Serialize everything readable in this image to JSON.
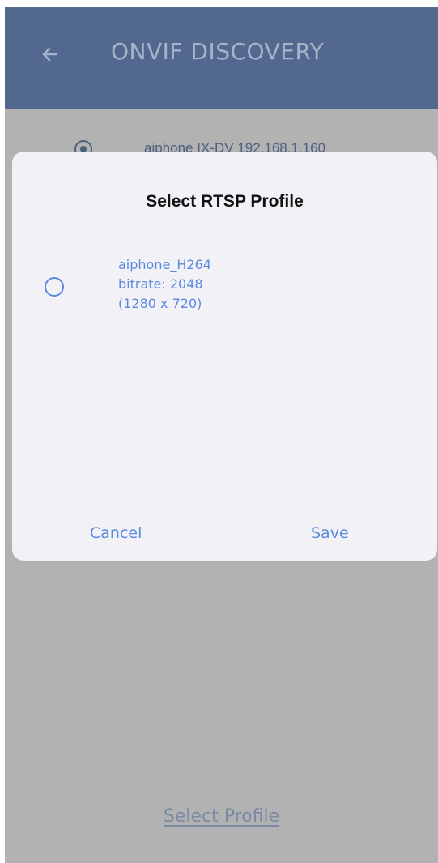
{
  "header": {
    "title": "ONVIF DISCOVERY",
    "back_icon": "arrow-left-icon"
  },
  "device_list": {
    "items": [
      {
        "label": "aiphone IX-DV 192.168.1.160",
        "selected": true
      }
    ]
  },
  "footer": {
    "select_profile_label": "Select Profile"
  },
  "dialog": {
    "title": "Select RTSP Profile",
    "options": [
      {
        "name": "aiphone_H264",
        "bitrate": "bitrate: 2048",
        "resolution": "(1280 x 720)",
        "selected": false
      }
    ],
    "cancel_label": "Cancel",
    "save_label": "Save"
  },
  "colors": {
    "header_bg": "#52688e",
    "overlay_bg": "#b2b2b2",
    "accent": "#5b8ae0",
    "dialog_bg": "#f1f1f6"
  }
}
